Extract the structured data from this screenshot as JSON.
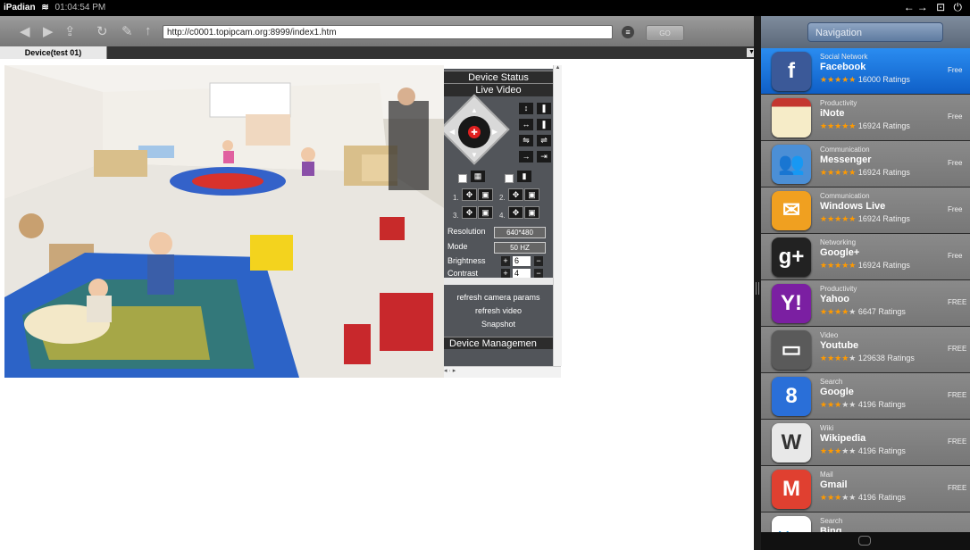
{
  "status_bar": {
    "carrier": "iPadian",
    "time": "01:04:54 PM",
    "controls": "←→ ⊡ ⏻"
  },
  "browser": {
    "url": "http://c0001.topipcam.org:8999/index1.htm",
    "go_label": "GO",
    "tab_label": "Device(test 01)"
  },
  "camera_panel": {
    "device_status": "Device Status",
    "live_video": "Live Video",
    "presets": [
      "1.",
      "2.",
      "3.",
      "4."
    ],
    "resolution_label": "Resolution",
    "resolution_value": "640*480",
    "mode_label": "Mode",
    "mode_value": "50 HZ",
    "brightness_label": "Brightness",
    "brightness_value": "6",
    "contrast_label": "Contrast",
    "contrast_value": "4",
    "refresh_params": "refresh camera params",
    "refresh_video": "refresh video",
    "snapshot": "Snapshot",
    "device_management": "Device Managemen"
  },
  "sidebar": {
    "nav_label": "Navigation",
    "apps": [
      {
        "category": "Social Network",
        "name": "Facebook",
        "stars": "★★★★★",
        "empty_stars": "",
        "ratings": "16000 Ratings",
        "price": "Free",
        "icon": "facebook-icon",
        "glyph": "f",
        "color": "#3b5998"
      },
      {
        "category": "Productivity",
        "name": "iNote",
        "stars": "★★★★★",
        "empty_stars": "",
        "ratings": "16924 Ratings",
        "price": "Free",
        "icon": "notepad-icon",
        "glyph": "",
        "color": "#c4372f"
      },
      {
        "category": "Communication",
        "name": "Messenger",
        "stars": "★★★★★",
        "empty_stars": "",
        "ratings": "16924 Ratings",
        "price": "Free",
        "icon": "messenger-icon",
        "glyph": "👥",
        "color": "#4b8fd6"
      },
      {
        "category": "Communication",
        "name": "Windows Live",
        "stars": "★★★★★",
        "empty_stars": "",
        "ratings": "16924 Ratings",
        "price": "Free",
        "icon": "mail-envelope-icon",
        "glyph": "✉",
        "color": "#f0a020"
      },
      {
        "category": "Networking",
        "name": "Google+",
        "stars": "★★★★★",
        "empty_stars": "",
        "ratings": "16924 Ratings",
        "price": "Free",
        "icon": "google-plus-icon",
        "glyph": "g+",
        "color": "#222222"
      },
      {
        "category": "Productivity",
        "name": "Yahoo",
        "stars": "★★★★",
        "empty_stars": "★",
        "ratings": "6647 Ratings",
        "price": "FREE",
        "icon": "yahoo-icon",
        "glyph": "Y!",
        "color": "#7b1fa2"
      },
      {
        "category": "Video",
        "name": "Youtube",
        "stars": "★★★★",
        "empty_stars": "★",
        "ratings": "129638 Ratings",
        "price": "FREE",
        "icon": "youtube-tv-icon",
        "glyph": "▭",
        "color": "#5a5a5a"
      },
      {
        "category": "Search",
        "name": "Google",
        "stars": "★★★",
        "empty_stars": "★★",
        "ratings": "4196 Ratings",
        "price": "FREE",
        "icon": "google-search-icon",
        "glyph": "8",
        "color": "#2a6fd8"
      },
      {
        "category": "Wiki",
        "name": "Wikipedia",
        "stars": "★★★",
        "empty_stars": "★★",
        "ratings": "4196 Ratings",
        "price": "FREE",
        "icon": "wikipedia-globe-icon",
        "glyph": "W",
        "color": "#e8e8e8"
      },
      {
        "category": "Mail",
        "name": "Gmail",
        "stars": "★★★",
        "empty_stars": "★★",
        "ratings": "4196 Ratings",
        "price": "FREE",
        "icon": "gmail-icon",
        "glyph": "M",
        "color": "#e04030"
      },
      {
        "category": "Search",
        "name": "Bing",
        "stars": "",
        "empty_stars": "",
        "ratings": "",
        "price": "",
        "icon": "bing-icon",
        "glyph": "bing",
        "color": "#ffffff"
      }
    ]
  }
}
